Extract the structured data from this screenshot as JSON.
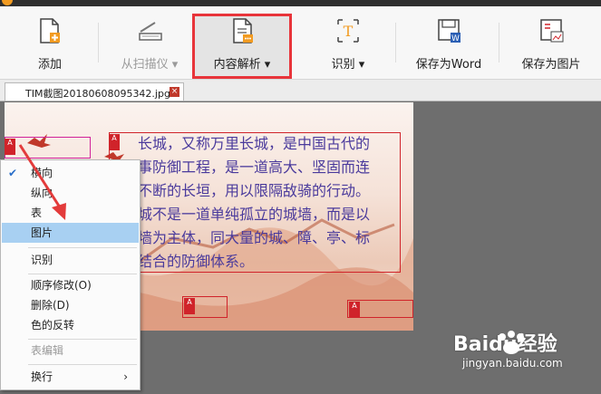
{
  "toolbar": {
    "add": "添加",
    "scan": "从扫描仪",
    "content": "内容解析",
    "recognize": "识别",
    "save_word": "保存为Word",
    "save_image": "保存为图片"
  },
  "tab": {
    "filename": "TIM截图20180608095342.jpg"
  },
  "ocr_text": [
    "长城，又称万里长城，是中国古代的",
    "事防御工程，是一道高大、坚固而连",
    "不断的长垣，用以限隔敌骑的行动。",
    "城不是一道单纯孤立的城墙，而是以",
    "墙为主体，同大量的城、障、亭、标",
    "结合的防御体系。"
  ],
  "context_menu": {
    "items": [
      {
        "label": "横向",
        "checked": true
      },
      {
        "label": "纵向"
      },
      {
        "label": "表"
      },
      {
        "label": "图片",
        "selected": true
      },
      {
        "label": "识别"
      },
      {
        "label": "顺序修改(O)"
      },
      {
        "label": "删除(D)"
      },
      {
        "label": "色的反转"
      },
      {
        "label": "表编辑",
        "disabled": true
      },
      {
        "label": "换行",
        "submenu": true
      }
    ]
  },
  "watermark": {
    "brand": "Baidu经验",
    "url": "jingyan.baidu.com"
  },
  "colors": {
    "highlight_border": "#e8343a",
    "zone_red": "#d0232a",
    "selected": "#a8d0f2",
    "ocr_text": "#4a3a9c"
  }
}
